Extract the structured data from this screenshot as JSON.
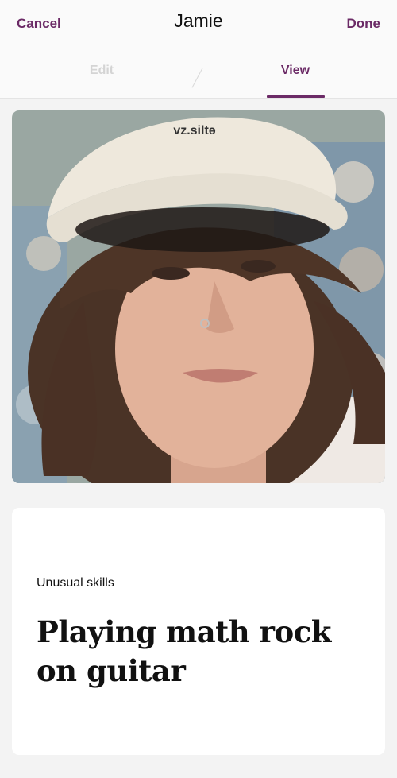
{
  "header": {
    "cancel_label": "Cancel",
    "title": "Jamie",
    "done_label": "Done"
  },
  "tabs": {
    "edit_label": "Edit",
    "view_label": "View",
    "active": "View"
  },
  "photo": {
    "description": "profile-photo",
    "cap_text": "vz.siltə"
  },
  "prompt_card": {
    "prompt": "Unusual skills",
    "answer": "Playing math rock on guitar"
  },
  "colors": {
    "accent": "#6b2a66",
    "background": "#f3f3f3",
    "card": "#ffffff",
    "tab_inactive": "#d4d4d4"
  }
}
